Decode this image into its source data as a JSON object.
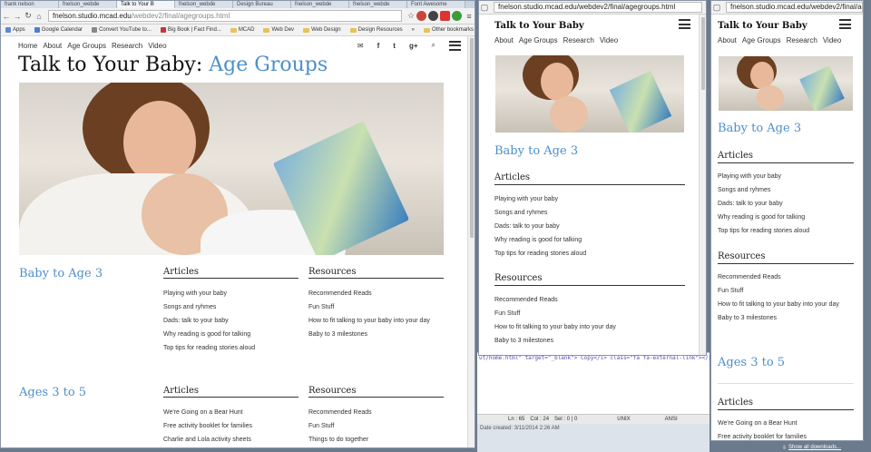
{
  "window1": {
    "tabs": [
      "frank nelson",
      "fnelson_webde",
      "Talk to Your B",
      "fnelson_webde",
      "Design Bureau",
      "fnelson_webde",
      "fnelson_webde",
      "Font Awesome"
    ],
    "url_host": "fnelson.studio.mcad.edu",
    "url_path": "/webdev2/final/agegroups.html",
    "bookmarks": [
      "Apps",
      "Google Calendar",
      "Convert YouTube to...",
      "Big Book | Fact Find...",
      "MCAD",
      "Web Dev",
      "Web Design",
      "Design Resources"
    ],
    "other_bookmarks": "Other bookmarks",
    "more": "»"
  },
  "site": {
    "nav": [
      "Home",
      "About",
      "Age Groups",
      "Research",
      "Video"
    ],
    "narrow_nav": [
      "About",
      "Age Groups",
      "Research",
      "Video"
    ],
    "brand": "Talk to Your Baby",
    "title_main": "Talk to Your Baby: ",
    "title_accent": "Age Groups",
    "icons": {
      "mail": "✉",
      "facebook": "f",
      "twitter": "t",
      "google": "g+",
      "search": "⌕"
    },
    "section1": "Baby to Age 3",
    "section2": "Ages 3 to 5",
    "articles_heading": "Articles",
    "resources_heading": "Resources",
    "articles1": [
      "Playing with your baby",
      "Songs and ryhmes",
      "Dads: talk to your baby",
      "Why reading is good for talking",
      "Top tips for reading stories aloud"
    ],
    "resources1": [
      "Recommended Reads",
      "Fun Stuff",
      "How to fit talking to your baby into your day",
      "Baby to 3 milestones"
    ],
    "articles2": [
      "We're Going on a Bear Hunt",
      "Free activity booklet for families",
      "Charlie and Lola activity sheets"
    ],
    "resources2": [
      "Recommended Reads",
      "Fun Stuff",
      "Things to do together"
    ]
  },
  "window2": {
    "url": "fnelson.studio.mcad.edu/webdev2/final/agegroups.html"
  },
  "window3": {
    "url": "fnelson.studio.mcad.edu/webdev2/final/agec"
  },
  "editor": {
    "code": "ut/home.html\" target=\"_blank\"> Copy</i> class=\"fa fa-external-link\"></i>",
    "status_ln": "Ln : 65",
    "status_col": "Col : 24",
    "status_sel": "Sel : 0 | 0",
    "status_eol": "UNIX",
    "status_enc": "ANSI",
    "date_created": "Date created: 3/11/2014 2:26 AM"
  },
  "downloads": "Show all downloads..."
}
